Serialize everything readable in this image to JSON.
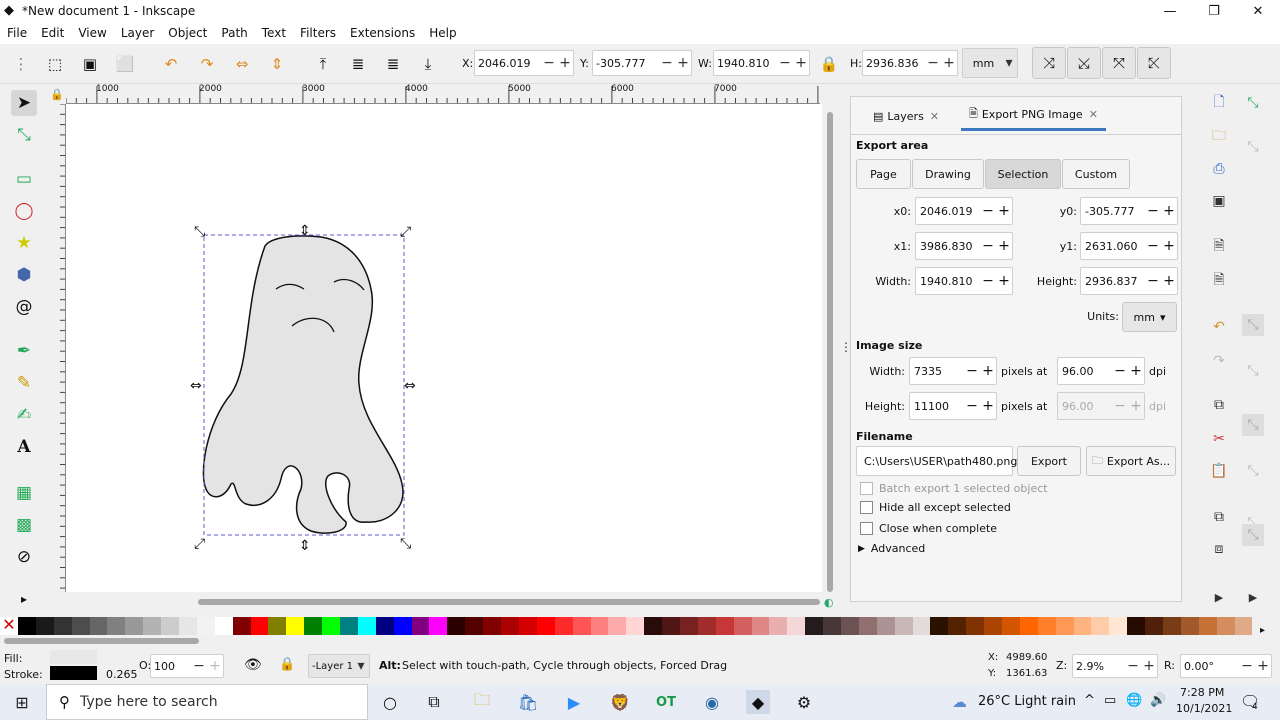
{
  "window": {
    "title": "*New document 1 - Inkscape",
    "minimize": "—",
    "restore": "❐",
    "close": "✕"
  },
  "menu": [
    "File",
    "Edit",
    "View",
    "Layer",
    "Object",
    "Path",
    "Text",
    "Filters",
    "Extensions",
    "Help"
  ],
  "toolbar": {
    "x_label": "X:",
    "x_value": "2046.019",
    "y_label": "Y:",
    "y_value": "-305.777",
    "w_label": "W:",
    "w_value": "1940.810",
    "h_label": "H:",
    "h_value": "2936.836",
    "units": "mm"
  },
  "ruler_top": [
    "1000",
    "2000",
    "3000",
    "4000",
    "5000",
    "6000",
    "7000"
  ],
  "dock": {
    "tabs": [
      {
        "label": "Layers"
      },
      {
        "label": "Export PNG Image"
      }
    ],
    "export_area_title": "Export area",
    "area_buttons": [
      "Page",
      "Drawing",
      "Selection",
      "Custom"
    ],
    "selected_area": "Selection",
    "x0_label": "x0:",
    "x0": "2046.019",
    "y0_label": "y0:",
    "y0": "-305.777",
    "x1_label": "x1:",
    "x1": "3986.830",
    "y1_label": "y1:",
    "y1": "2631.060",
    "width_label": "Width:",
    "width": "1940.810",
    "height_label": "Height:",
    "height": "2936.837",
    "units_label": "Units:",
    "units": "mm",
    "image_size_title": "Image size",
    "img_width_label": "Width:",
    "img_width": "7335",
    "img_height_label": "Height:",
    "img_height": "11100",
    "pixels_at": "pixels at",
    "dpi_value": "96.00",
    "dpi_value_disabled": "96.00",
    "dpi": "dpi",
    "filename_title": "Filename",
    "filename": "C:\\Users\\USER\\path480.png",
    "export_button": "Export",
    "export_as_button": "Export As...",
    "batch_export": "Batch export 1 selected object",
    "hide_all": "Hide all except selected",
    "close_when_complete": "Close when complete",
    "advanced": "Advanced"
  },
  "status": {
    "fill_label": "Fill:",
    "stroke_label": "Stroke:",
    "stroke_width": "0.265",
    "opacity_label": "O:",
    "opacity": "100",
    "layer": "-Layer 1",
    "message_bold": "Alt:",
    "message": "Select with touch-path, Cycle through objects, Forced Drag",
    "x_label": "X:",
    "x": "4989.60",
    "y_label": "Y:",
    "y": "1361.63",
    "zoom_label": "Z:",
    "zoom": "2.9%",
    "rotate_label": "R:",
    "rotate": "0.00°"
  },
  "taskbar": {
    "search_placeholder": "Type here to search",
    "weather": "26°C  Light rain",
    "time": "7:28 PM",
    "date": "10/1/2021",
    "notification_count": "4"
  },
  "colors": {
    "accent": "#3b78c2",
    "selection": "#5a5ad8"
  }
}
